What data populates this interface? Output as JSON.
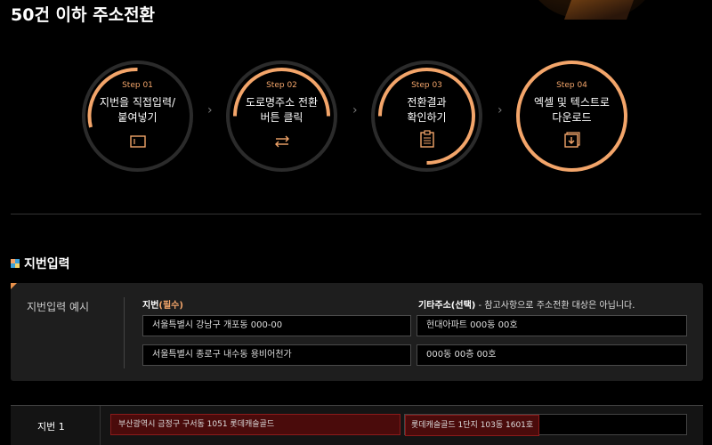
{
  "page_title": "50건 이하 주소전환",
  "steps": [
    {
      "step": "Step 01",
      "text": "지번을 직접입력/\n붙여넣기",
      "icon": "input-box-icon"
    },
    {
      "step": "Step 02",
      "text": "도로명주소 전환\n버튼 클릭",
      "icon": "convert-arrows-icon"
    },
    {
      "step": "Step 03",
      "text": "전환결과\n확인하기",
      "icon": "clipboard-icon"
    },
    {
      "step": "Step 04",
      "text": "엑셀 및 텍스트로\n다운로드",
      "icon": "download-icon"
    }
  ],
  "section": {
    "title": "지번입력"
  },
  "example": {
    "label": "지번입력 예시",
    "col1_label": "지번",
    "col1_required": "(필수)",
    "col2_label": "기타주소(선택)",
    "col2_note": " - 참고사항으로 주소전환 대상은 아닙니다.",
    "rows": [
      {
        "jibun": "서울특별시 강남구 개포동 000-00",
        "etc": "현대아파트 000동 00호"
      },
      {
        "jibun": "서울특별시 종로구 내수동 용비어천가",
        "etc": "000동 00층 00호"
      }
    ]
  },
  "input_row": {
    "label": "지번 1",
    "jibun_value": "부산광역시 금정구 구서동 1051 롯데캐슬골드",
    "etc_value": "롯데캐슬골드 1단지 103동 1601호"
  },
  "colors": {
    "accent": "#f3a56a",
    "ring_track": "#2b2b2b",
    "error_bg": "#4a0b0b"
  }
}
